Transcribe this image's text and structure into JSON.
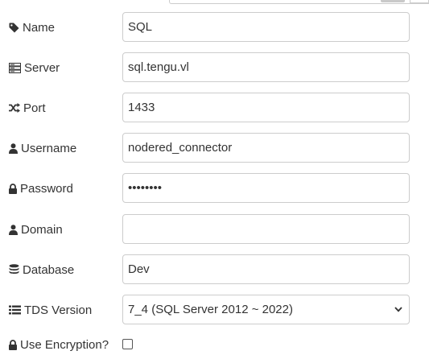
{
  "form": {
    "name": {
      "label": "Name",
      "value": "SQL",
      "icon": "tag-icon"
    },
    "server": {
      "label": "Server",
      "value": "sql.tengu.vl",
      "icon": "server-icon"
    },
    "port": {
      "label": "Port",
      "value": "1433",
      "icon": "random-icon"
    },
    "username": {
      "label": "Username",
      "value": "nodered_connector",
      "icon": "user-icon"
    },
    "password": {
      "label": "Password",
      "value": "••••••••",
      "icon": "lock-icon"
    },
    "domain": {
      "label": "Domain",
      "value": "",
      "icon": "user-icon"
    },
    "database": {
      "label": "Database",
      "value": "Dev",
      "icon": "database-icon"
    },
    "tds_version": {
      "label": "TDS Version",
      "selected": "7_4 (SQL Server 2012 ~ 2022)",
      "icon": "list-icon"
    },
    "use_encryption": {
      "label": "Use Encryption?",
      "checked": false,
      "icon": "lock-icon"
    }
  }
}
